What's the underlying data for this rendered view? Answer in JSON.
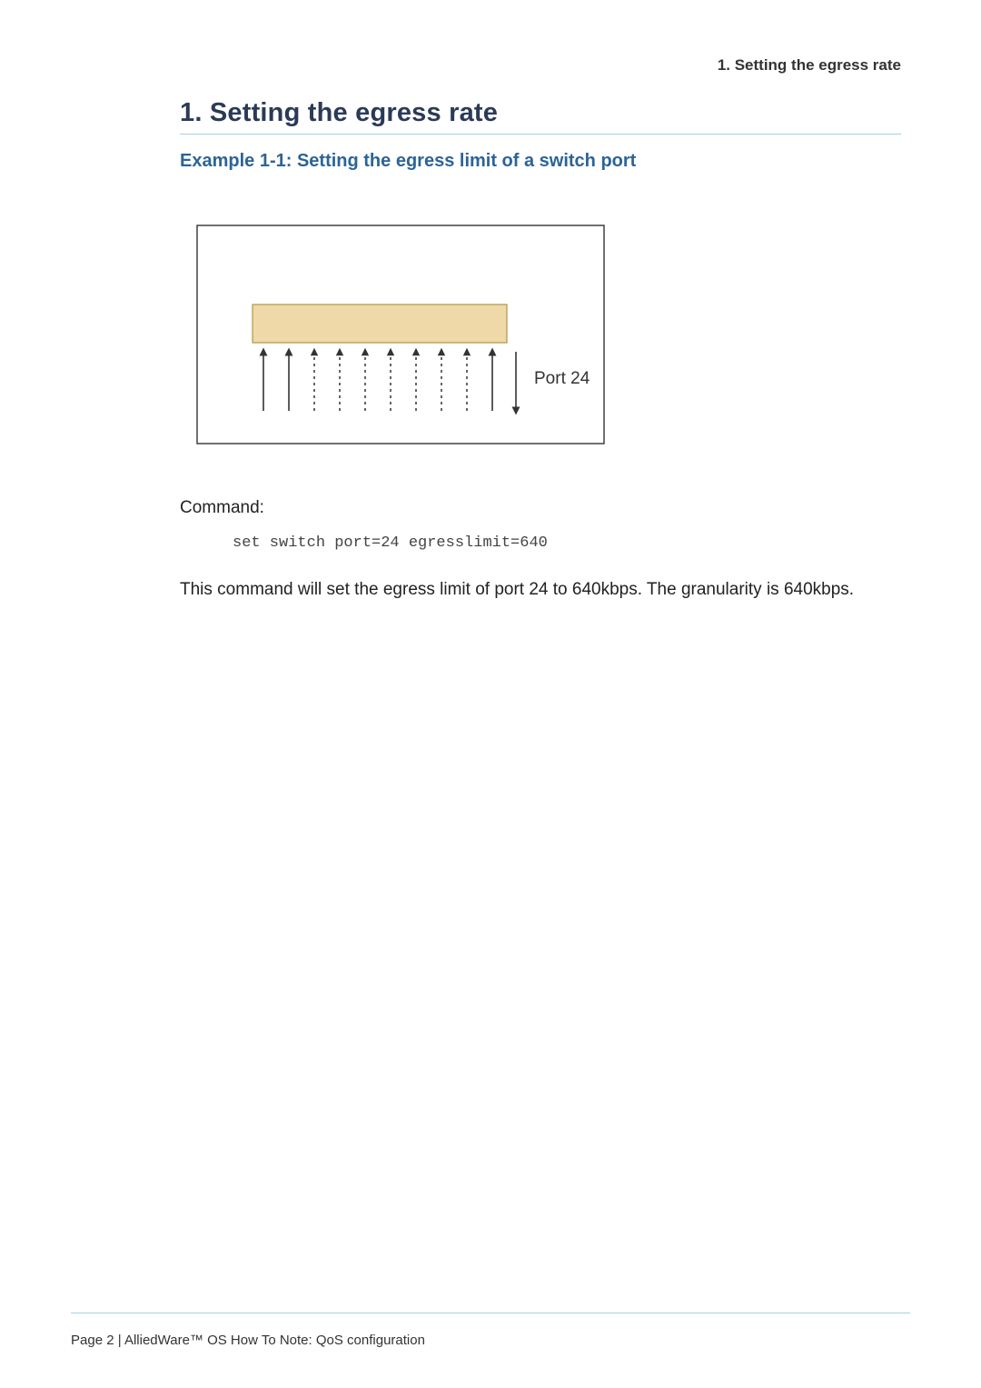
{
  "header": {
    "running_title": "1. Setting the egress rate"
  },
  "section": {
    "title": "1. Setting the egress rate",
    "example_title": "Example 1-1: Setting the egress limit of a switch port"
  },
  "figure": {
    "port_label": "Port 24"
  },
  "command": {
    "label": "Command:",
    "code": "set switch port=24 egresslimit=640"
  },
  "body": {
    "paragraph": "This command will set the egress limit of port 24 to 640kbps. The granularity is 640kbps."
  },
  "footer": {
    "text": "Page 2 | AlliedWare™ OS How To Note: QoS configuration"
  },
  "colors": {
    "heading": "#2b3a57",
    "subheading": "#2c6496",
    "rule": "#a9cfe3",
    "box_fill": "#efd9a8",
    "box_stroke": "#b19644"
  }
}
